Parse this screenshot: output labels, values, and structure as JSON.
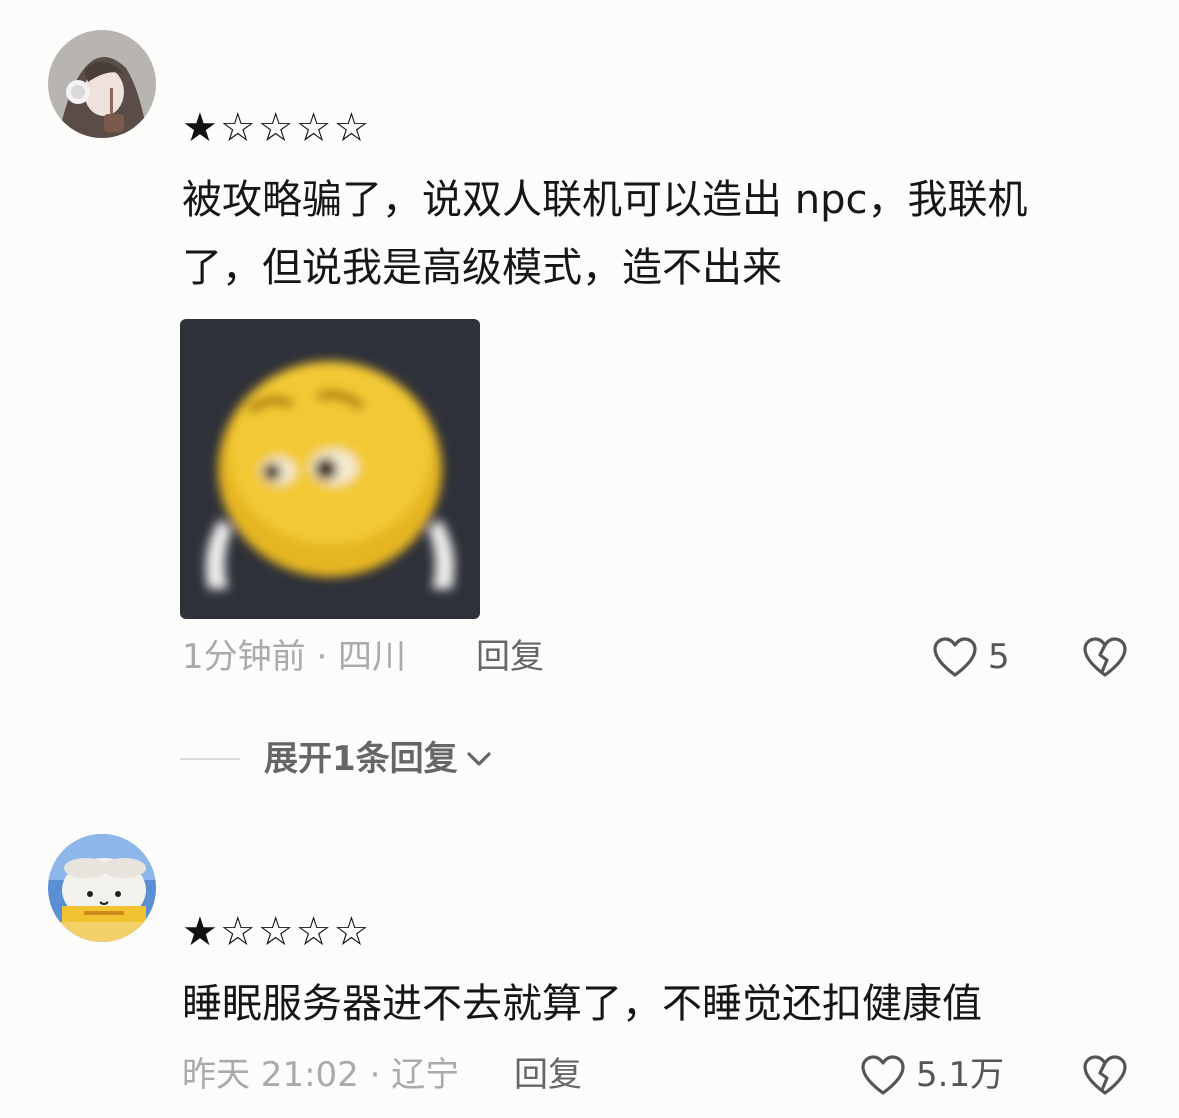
{
  "comments": [
    {
      "rating_stars": "★☆☆☆☆",
      "text_line1": "被攻略骗了，说双人联机可以造出 npc，我联机",
      "text_line2": "了，但说我是高级模式，造不出来",
      "meta": "1分钟前 · 四川",
      "reply_label": "回复",
      "like_count": "5",
      "expand_label": "展开1条回复"
    },
    {
      "rating_stars": "★☆☆☆☆",
      "text_line1": "睡眠服务器进不去就算了，不睡觉还扣健康值",
      "meta": "昨天 21:02 · 辽宁",
      "reply_label": "回复",
      "like_count": "5.1万"
    }
  ],
  "icons": {
    "like": "heart-outline-icon",
    "dislike": "broken-heart-icon",
    "expand": "chevron-down-icon"
  },
  "colors": {
    "background": "#fcfcfa",
    "text": "#161616",
    "meta": "#aaaaaa",
    "secondary": "#666666"
  }
}
